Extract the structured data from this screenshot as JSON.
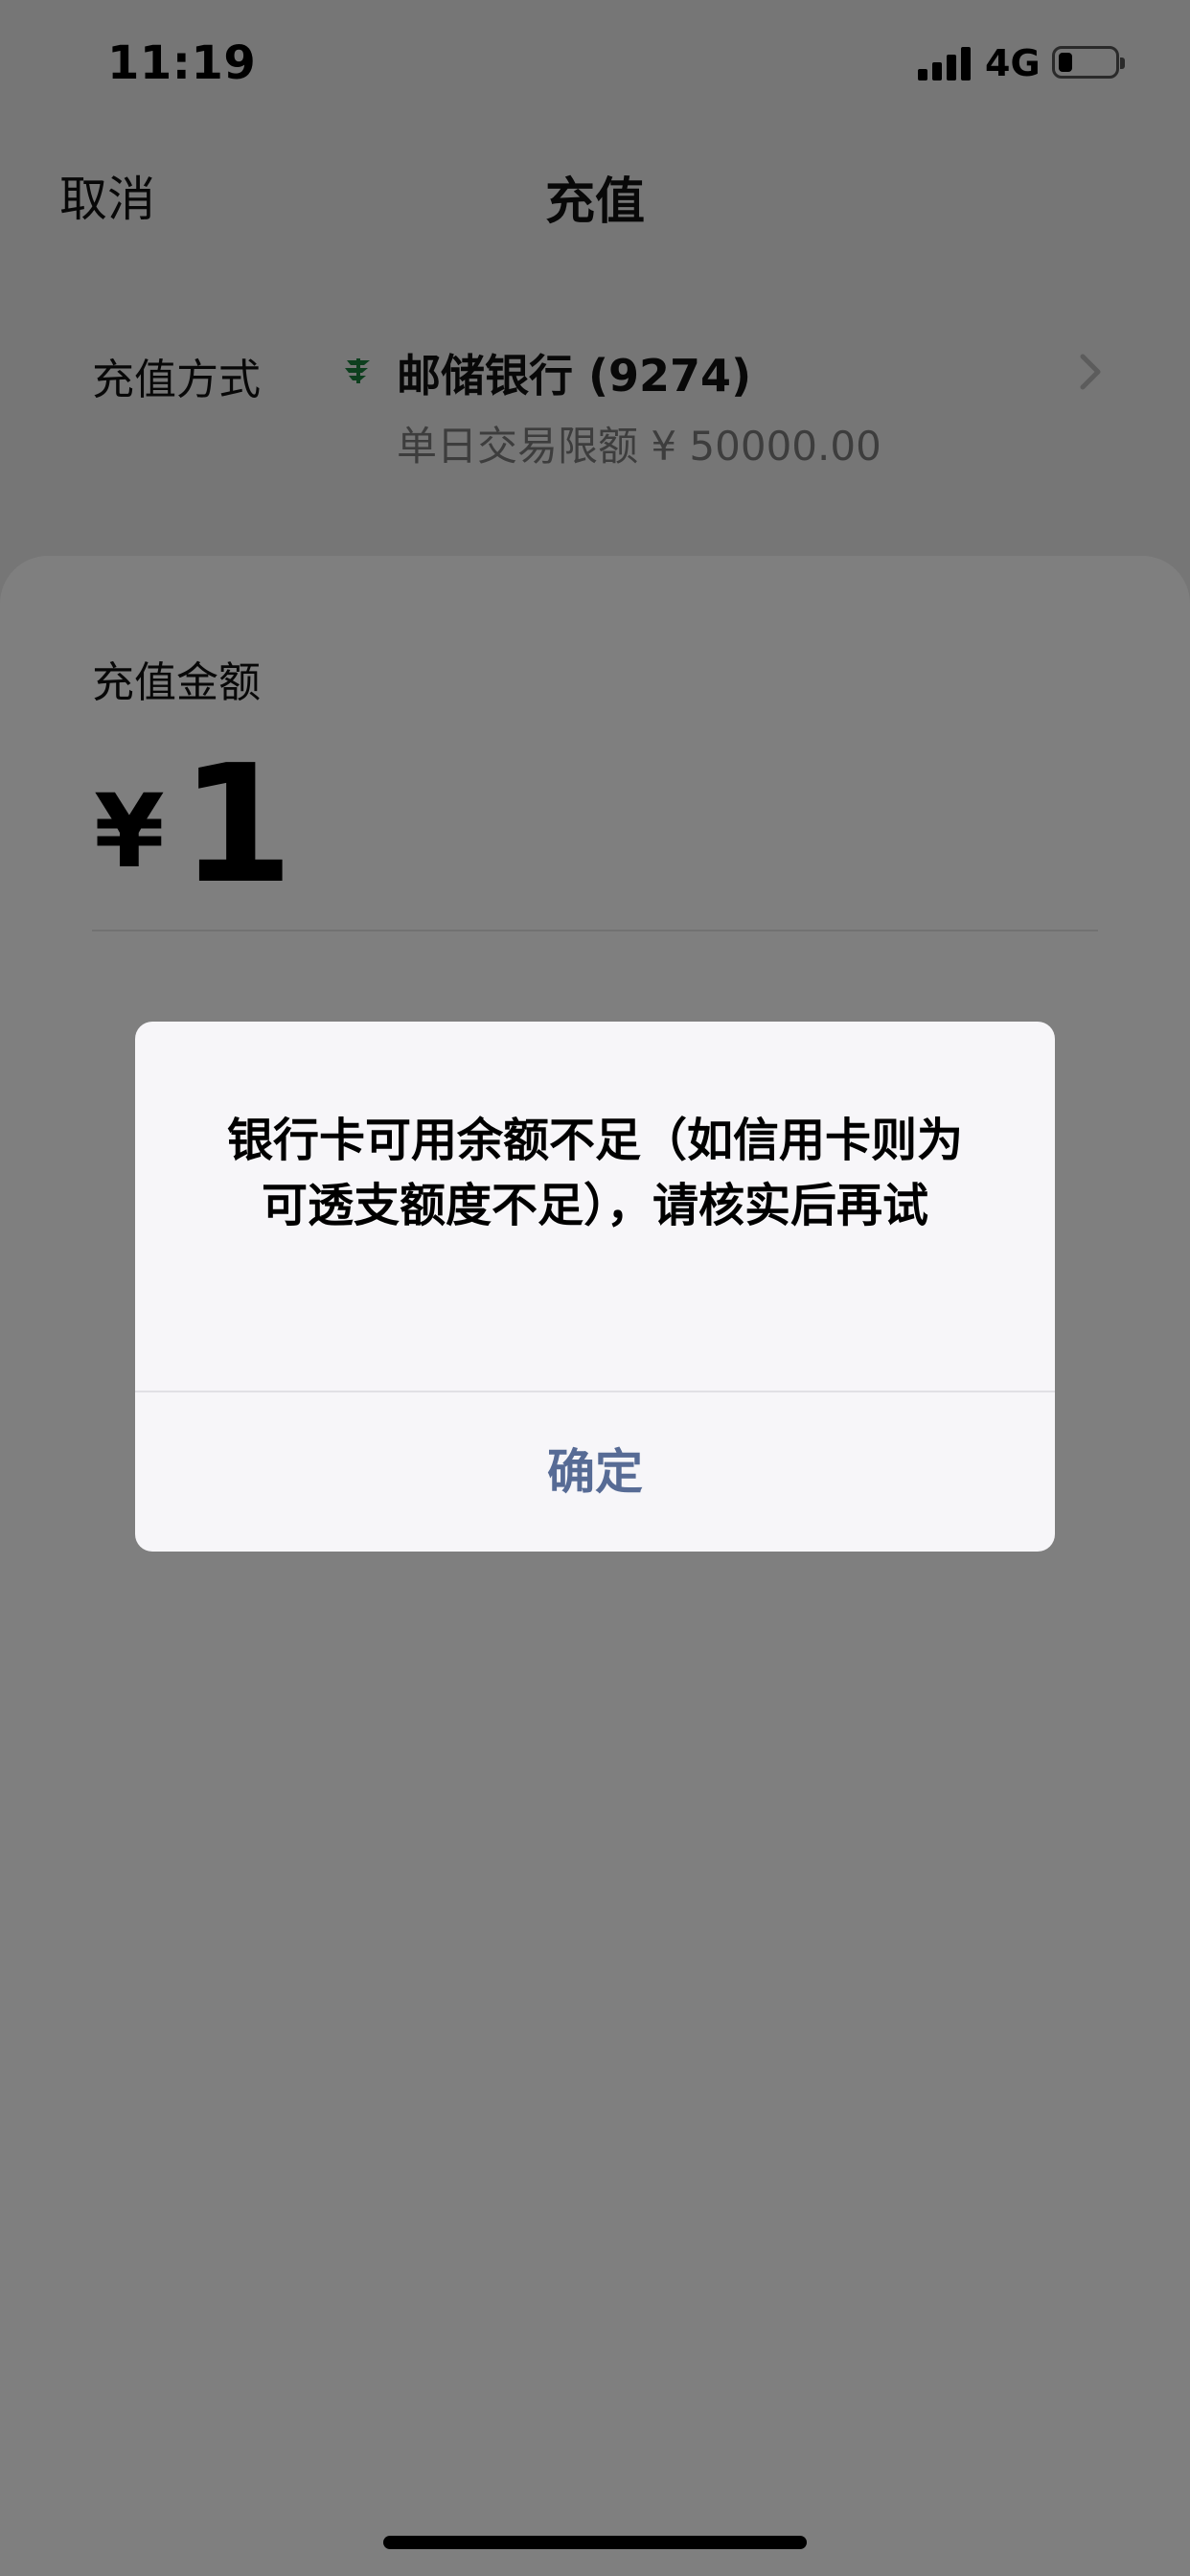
{
  "status_bar": {
    "time": "11:19",
    "network": "4G",
    "battery_level": 0.25
  },
  "nav": {
    "cancel_label": "取消",
    "title": "充值"
  },
  "payment_method": {
    "label": "充值方式",
    "bank_icon": "postal-bank-icon",
    "bank_name": "邮储银行 (9274)",
    "daily_limit": "单日交易限额 ¥ 50000.00"
  },
  "amount": {
    "label": "充值金额",
    "currency": "¥",
    "value": "1"
  },
  "dialog": {
    "message": "银行卡可用余额不足（如信用卡则为可透支额度不足），请核实后再试",
    "confirm_label": "确定"
  },
  "colors": {
    "link_blue": "#576b95",
    "bank_green": "#1a7f3c",
    "overlay": "rgba(0,0,0,0.5)"
  }
}
